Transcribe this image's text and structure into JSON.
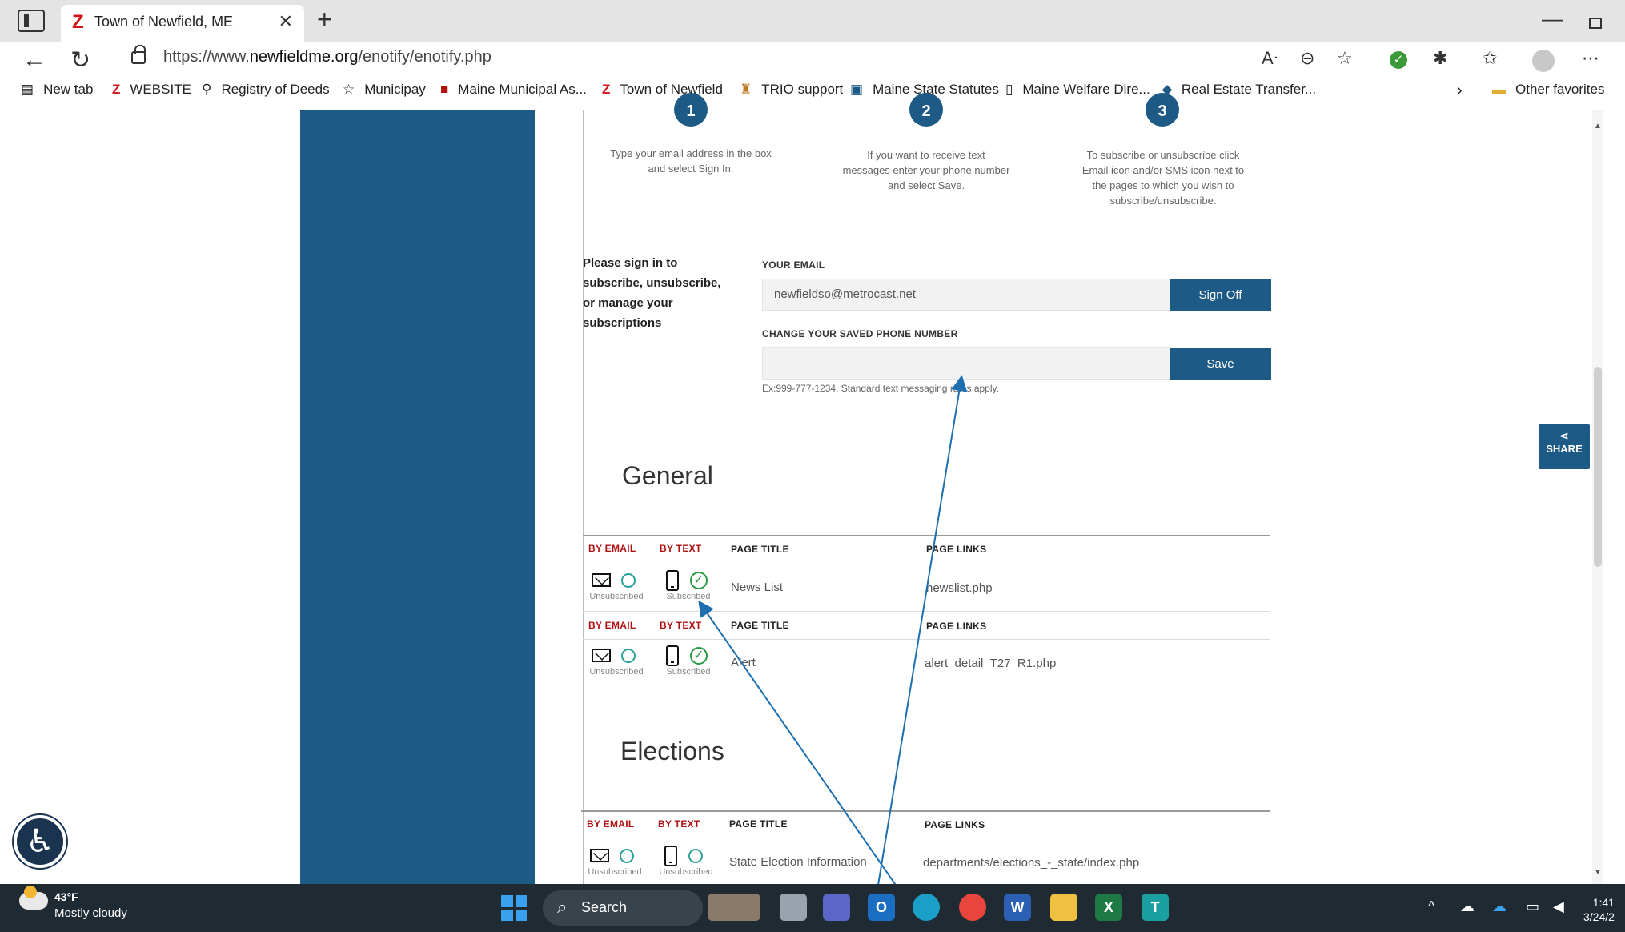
{
  "browser": {
    "tab_title": "Town of Newfield, ME",
    "tab_favicon": "Z",
    "url_prefix": "https://www.",
    "url_domain": "newfieldme.org",
    "url_path": "/enotify/enotify.php",
    "new_tab_glyph": "+",
    "close_glyph": "✕"
  },
  "favorites": [
    {
      "label": "New tab",
      "icon": "▤"
    },
    {
      "label": "WEBSITE",
      "icon": "Z"
    },
    {
      "label": "Registry of Deeds",
      "icon": "⚲"
    },
    {
      "label": "Municipay",
      "icon": "☆"
    },
    {
      "label": "Maine Municipal As...",
      "icon": "■"
    },
    {
      "label": "Town of Newfield",
      "icon": "Z"
    },
    {
      "label": "TRIO support",
      "icon": "♜"
    },
    {
      "label": "Maine State Statutes",
      "icon": "▣"
    },
    {
      "label": "Maine Welfare Dire...",
      "icon": "▯"
    },
    {
      "label": "Real Estate Transfer...",
      "icon": "⬥"
    }
  ],
  "other_favorites": "Other favorites",
  "steps": [
    {
      "num": "1",
      "text": "Type your email address in the box and select Sign In."
    },
    {
      "num": "2",
      "text": "If you want to receive text messages enter your phone number and select Save."
    },
    {
      "num": "3",
      "text": "To subscribe or unsubscribe click Email icon and/or SMS icon next to the pages to which you wish to subscribe/unsubscribe."
    }
  ],
  "signin": {
    "prompt": "Please sign in to subscribe, unsubscribe, or manage your subscriptions",
    "email_label": "YOUR EMAIL",
    "email_value": "newfieldso@metrocast.net",
    "signoff_label": "Sign Off",
    "phone_label": "CHANGE YOUR SAVED PHONE NUMBER",
    "phone_value": "",
    "save_label": "Save",
    "hint": "Ex:999-777-1234. Standard text messaging rates apply."
  },
  "columns": {
    "by_email": "BY EMAIL",
    "by_text": "BY TEXT",
    "page_title": "PAGE TITLE",
    "page_links": "PAGE LINKS"
  },
  "sections": {
    "general": {
      "title": "General",
      "rows": [
        {
          "email_status": "Unsubscribed",
          "text_status": "Subscribed",
          "page_title": "News List",
          "page_link": "newslist.php"
        },
        {
          "email_status": "Unsubscribed",
          "text_status": "Subscribed",
          "page_title": "Alert",
          "page_link": "alert_detail_T27_R1.php"
        }
      ]
    },
    "elections": {
      "title": "Elections",
      "rows": [
        {
          "email_status": "Unsubscribed",
          "text_status": "Unsubscribed",
          "page_title": "State Election Information",
          "page_link": "departments/elections_-_state/index.php"
        }
      ]
    }
  },
  "share_label": "SHARE",
  "taskbar": {
    "temp": "43°F",
    "weather": "Mostly cloudy",
    "search": "Search",
    "time": "1:41",
    "date": "3/24/2"
  },
  "colors": {
    "brand_blue": "#1d5a86",
    "column_header_red": "#b01212",
    "subscribed_green": "#2c9a45",
    "unsubscribed_teal": "#27a39a"
  }
}
